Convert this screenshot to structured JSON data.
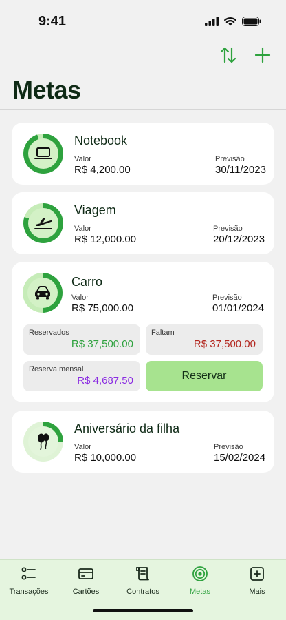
{
  "status": {
    "time": "9:41"
  },
  "header": {
    "title": "Metas",
    "sort_icon": "sort-arrows-icon",
    "add_icon": "plus-icon"
  },
  "goals": [
    {
      "name": "Notebook",
      "value_label": "Valor",
      "value": "R$ 4,200.00",
      "forecast_label": "Previsão",
      "forecast": "30/11/2023",
      "icon": "laptop-icon",
      "progress": 0.95
    },
    {
      "name": "Viagem",
      "value_label": "Valor",
      "value": "R$ 12,000.00",
      "forecast_label": "Previsão",
      "forecast": "20/12/2023",
      "icon": "airplane-icon",
      "progress": 0.8
    },
    {
      "name": "Carro",
      "value_label": "Valor",
      "value": "R$ 75,000.00",
      "forecast_label": "Previsão",
      "forecast": "01/01/2024",
      "icon": "car-icon",
      "progress": 0.5,
      "reserved_label": "Reservados",
      "reserved": "R$ 37,500.00",
      "missing_label": "Faltam",
      "missing": "R$ 37,500.00",
      "monthly_label": "Reserva mensal",
      "monthly": "R$ 4,687.50",
      "reserve_button": "Reservar"
    },
    {
      "name": "Aniversário da filha",
      "value_label": "Valor",
      "value": "R$ 10,000.00",
      "forecast_label": "Previsão",
      "forecast": "15/02/2024",
      "icon": "balloons-icon",
      "progress": 0.25
    }
  ],
  "colors": {
    "accent": "#2ea23e",
    "reserved": "#2ea23e",
    "missing": "#b3261e",
    "monthly": "#8a2be2",
    "button": "#a7e38f",
    "tabbar": "#e5f5df"
  },
  "tabs": [
    {
      "label": "Transações",
      "icon": "transactions-list-icon",
      "active": false
    },
    {
      "label": "Cartões",
      "icon": "credit-card-icon",
      "active": false
    },
    {
      "label": "Contratos",
      "icon": "contract-scroll-icon",
      "active": false
    },
    {
      "label": "Metas",
      "icon": "target-icon",
      "active": true
    },
    {
      "label": "Mais",
      "icon": "plus-square-icon",
      "active": false
    }
  ]
}
